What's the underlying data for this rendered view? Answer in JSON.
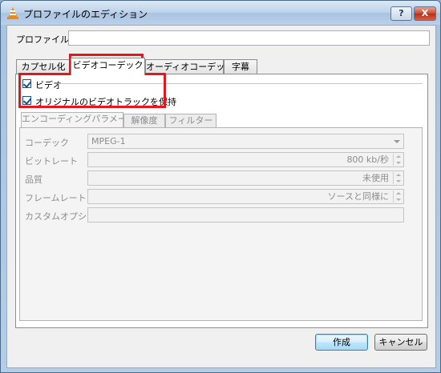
{
  "window": {
    "title": "プロファイルのエディション",
    "help_label": "?",
    "close_label": "X"
  },
  "profile": {
    "label": "プロファイル名",
    "value": ""
  },
  "tabs": [
    {
      "label": "カプセル化",
      "active": false
    },
    {
      "label": "ビデオコーデック",
      "active": true
    },
    {
      "label": "オーディオコーデック",
      "active": false
    },
    {
      "label": "字幕",
      "active": false
    }
  ],
  "video": {
    "video_checkbox_label": "ビデオ",
    "video_checked": true,
    "keep_track_label": "オリジナルのビデオトラックを保持",
    "keep_track_checked": true
  },
  "subtabs": [
    {
      "label": "エンコーディングパラメーター",
      "active": true
    },
    {
      "label": "解像度",
      "active": false
    },
    {
      "label": "フィルター",
      "active": false
    }
  ],
  "params": {
    "codec_label": "コーデック",
    "codec_value": "MPEG-1",
    "bitrate_label": "ビットレート",
    "bitrate_value": "800 kb/秒",
    "quality_label": "品質",
    "quality_value": "未使用",
    "framerate_label": "フレームレート",
    "framerate_value": "ソースと同様に",
    "custom_label": "カスタムオプション",
    "custom_value": ""
  },
  "buttons": {
    "create": "作成",
    "cancel": "キャンセル"
  },
  "colors": {
    "highlight": "#e8161b",
    "accent": "#3c7fb1"
  }
}
